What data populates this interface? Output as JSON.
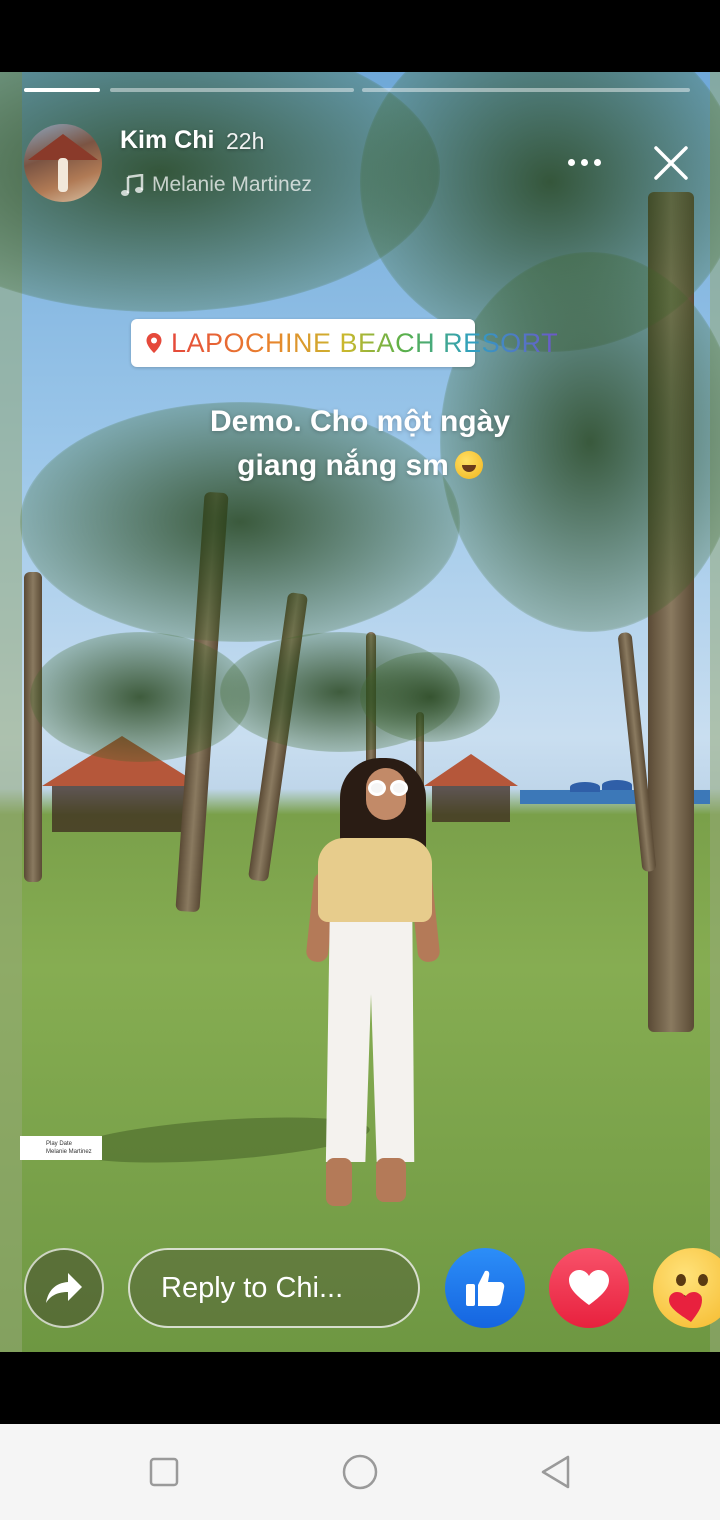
{
  "story": {
    "user_name": "Kim Chi",
    "post_time": "22h",
    "music_title": "Melanie Martinez",
    "location": "LAPOCHINE BEACH RESORT",
    "caption_line1": "Demo. Cho một ngày",
    "caption_line2": "giang nắng sm",
    "caption_emoji": "rolling-on-floor-laughing",
    "music_credit_line1": "Play Date",
    "music_credit_line2": "Melanie Martinez",
    "progress": [
      1.0,
      0.0,
      0.0
    ]
  },
  "reply": {
    "placeholder": "Reply to Chi..."
  },
  "reactions": {
    "like_color": "#1877f2",
    "love_color": "#f33e58",
    "care_color": "#f7b125"
  },
  "icons": {
    "share": "share-icon",
    "more": "more-icon",
    "close": "close-icon",
    "music": "music-note-icon",
    "pin": "location-pin-icon"
  }
}
